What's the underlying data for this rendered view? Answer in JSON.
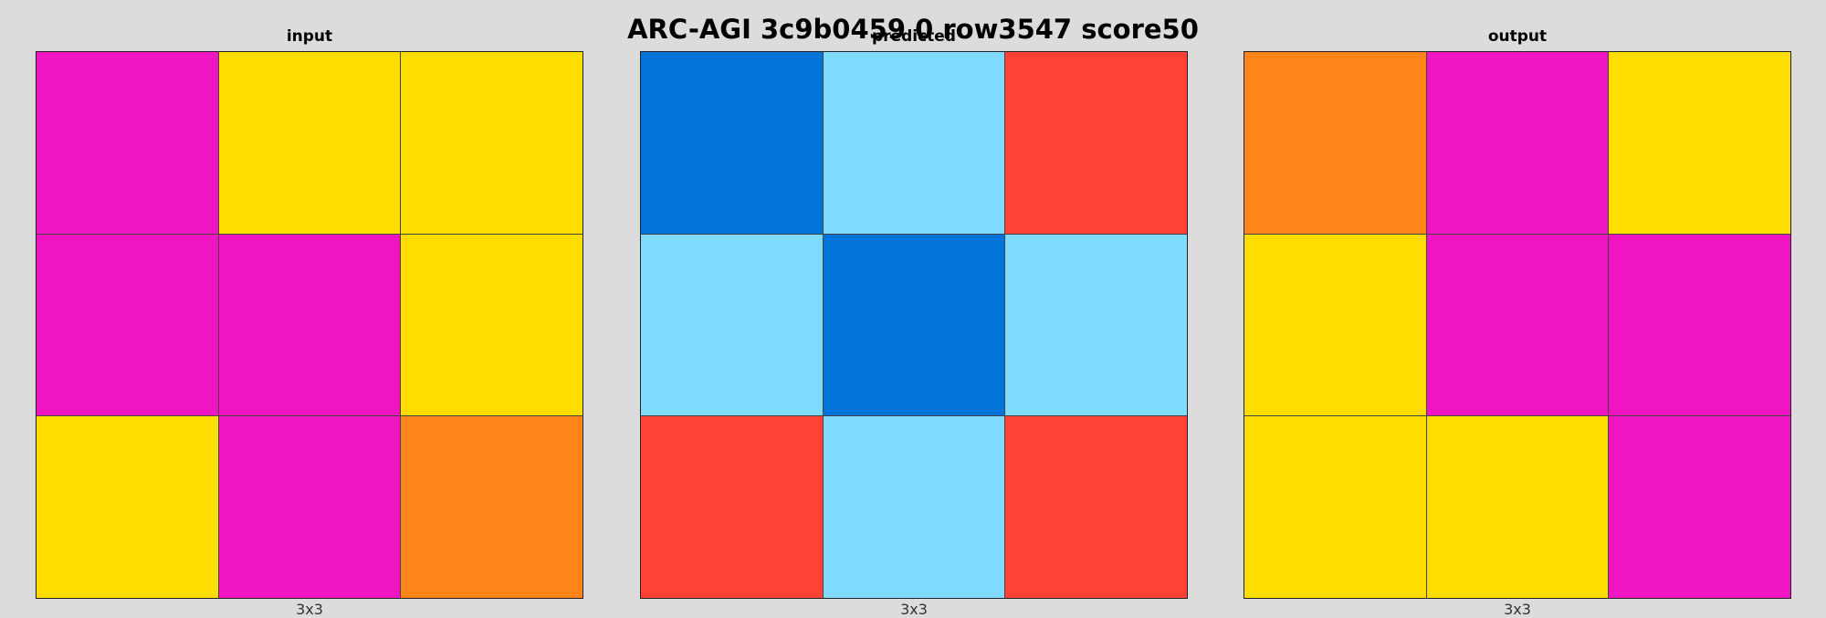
{
  "title": "ARC-AGI 3c9b0459 0 row3547 score50",
  "colors": {
    "magenta": "#f015c2",
    "yellow": "#ffdd00",
    "orange": "#ff851b",
    "blue": "#0074d9",
    "lightblue": "#7fdbff",
    "red": "#ff4136"
  },
  "panels": [
    {
      "label": "input",
      "caption": "3x3",
      "grid": [
        [
          "magenta",
          "yellow",
          "yellow"
        ],
        [
          "magenta",
          "magenta",
          "yellow"
        ],
        [
          "yellow",
          "magenta",
          "orange"
        ]
      ]
    },
    {
      "label": "predicted",
      "caption": "3x3",
      "grid": [
        [
          "blue",
          "lightblue",
          "red"
        ],
        [
          "lightblue",
          "blue",
          "lightblue"
        ],
        [
          "red",
          "lightblue",
          "red"
        ]
      ]
    },
    {
      "label": "output",
      "caption": "3x3",
      "grid": [
        [
          "orange",
          "magenta",
          "yellow"
        ],
        [
          "yellow",
          "magenta",
          "magenta"
        ],
        [
          "yellow",
          "yellow",
          "magenta"
        ]
      ]
    }
  ]
}
